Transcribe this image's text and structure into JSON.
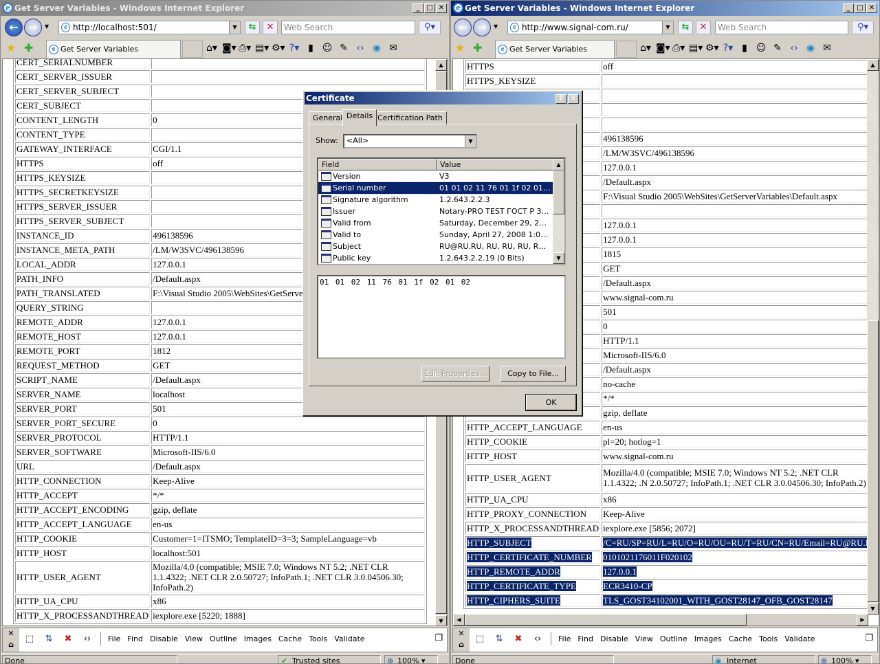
{
  "left_window": {
    "title": "Get Server Variables - Windows Internet Explorer",
    "address": "http://localhost:501/",
    "search_placeholder": "Web Search",
    "tab_label": "Get Server Variables",
    "active": false,
    "rows": [
      [
        "CERT_SERIALNUMBER",
        ""
      ],
      [
        "CERT_SERVER_ISSUER",
        ""
      ],
      [
        "CERT_SERVER_SUBJECT",
        ""
      ],
      [
        "CERT_SUBJECT",
        ""
      ],
      [
        "CONTENT_LENGTH",
        "0"
      ],
      [
        "CONTENT_TYPE",
        ""
      ],
      [
        "GATEWAY_INTERFACE",
        "CGI/1.1"
      ],
      [
        "HTTPS",
        "off"
      ],
      [
        "HTTPS_KEYSIZE",
        ""
      ],
      [
        "HTTPS_SECRETKEYSIZE",
        ""
      ],
      [
        "HTTPS_SERVER_ISSUER",
        ""
      ],
      [
        "HTTPS_SERVER_SUBJECT",
        ""
      ],
      [
        "INSTANCE_ID",
        "496138596"
      ],
      [
        "INSTANCE_META_PATH",
        "/LM/W3SVC/496138596"
      ],
      [
        "LOCAL_ADDR",
        "127.0.0.1"
      ],
      [
        "PATH_INFO",
        "/Default.aspx"
      ],
      [
        "PATH_TRANSLATED",
        "F:\\Visual Studio 2005\\WebSites\\GetServer"
      ],
      [
        "QUERY_STRING",
        ""
      ],
      [
        "REMOTE_ADDR",
        "127.0.0.1"
      ],
      [
        "REMOTE_HOST",
        "127.0.0.1"
      ],
      [
        "REMOTE_PORT",
        "1812"
      ],
      [
        "REQUEST_METHOD",
        "GET"
      ],
      [
        "SCRIPT_NAME",
        "/Default.aspx"
      ],
      [
        "SERVER_NAME",
        "localhost"
      ],
      [
        "SERVER_PORT",
        "501"
      ],
      [
        "SERVER_PORT_SECURE",
        "0"
      ],
      [
        "SERVER_PROTOCOL",
        "HTTP/1.1"
      ],
      [
        "SERVER_SOFTWARE",
        "Microsoft-IIS/6.0"
      ],
      [
        "URL",
        "/Default.aspx"
      ],
      [
        "HTTP_CONNECTION",
        "Keep-Alive"
      ],
      [
        "HTTP_ACCEPT",
        "*/*"
      ],
      [
        "HTTP_ACCEPT_ENCODING",
        "gzip, deflate"
      ],
      [
        "HTTP_ACCEPT_LANGUAGE",
        "en-us"
      ],
      [
        "HTTP_COOKIE",
        "Customer=1=ITSMO; TemplateID=3=3; SampleLanguage=vb"
      ],
      [
        "HTTP_HOST",
        "localhost:501"
      ],
      [
        "HTTP_USER_AGENT",
        "Mozilla/4.0 (compatible; MSIE 7.0; Windows NT 5.2; .NET CLR 1.1.4322; .NET CLR 2.0.50727; InfoPath.1; .NET CLR 3.0.04506.30; InfoPath.2)"
      ],
      [
        "HTTP_UA_CPU",
        "x86"
      ],
      [
        "HTTP_X_PROCESSANDTHREAD",
        "iexplore.exe [5220; 1888]"
      ]
    ],
    "status": "Done",
    "zone": "Trusted sites",
    "zoom": "100%"
  },
  "right_window": {
    "title": "Get Server Variables - Windows Internet Explorer",
    "address": "http://www.signal-com.ru/",
    "search_placeholder": "Web Search",
    "tab_label": "Get Server Variables",
    "active": true,
    "rows": [
      [
        "HTTPS",
        "off"
      ],
      [
        "HTTPS_KEYSIZE",
        ""
      ],
      [
        "",
        ""
      ],
      [
        "",
        ""
      ],
      [
        "",
        ""
      ],
      [
        "",
        "496138596"
      ],
      [
        "",
        "/LM/W3SVC/496138596"
      ],
      [
        "",
        "127.0.0.1"
      ],
      [
        "",
        "/Default.aspx"
      ],
      [
        "",
        "F:\\Visual Studio 2005\\WebSites\\GetServerVariables\\Default.aspx"
      ],
      [
        "",
        ""
      ],
      [
        "",
        "127.0.0.1"
      ],
      [
        "",
        "127.0.0.1"
      ],
      [
        "",
        "1815"
      ],
      [
        "",
        "GET"
      ],
      [
        "",
        "/Default.aspx"
      ],
      [
        "",
        "www.signal-com.ru"
      ],
      [
        "",
        "501"
      ],
      [
        "",
        "0"
      ],
      [
        "",
        "HTTP/1.1"
      ],
      [
        "",
        "Microsoft-IIS/6.0"
      ],
      [
        "",
        "/Default.aspx"
      ],
      [
        "",
        "no-cache"
      ],
      [
        "",
        "*/*"
      ],
      [
        "",
        "gzip, deflate"
      ],
      [
        "HTTP_ACCEPT_LANGUAGE",
        "en-us"
      ],
      [
        "HTTP_COOKIE",
        "pl=20; hotlog=1"
      ],
      [
        "HTTP_HOST",
        "www.signal-com.ru"
      ],
      [
        "HTTP_USER_AGENT",
        "Mozilla/4.0 (compatible; MSIE 7.0; Windows NT 5.2; .NET CLR 1.1.4322; .N 2.0.50727; InfoPath.1; .NET CLR 3.0.04506.30; InfoPath.2)"
      ],
      [
        "HTTP_UA_CPU",
        "x86"
      ],
      [
        "HTTP_PROXY_CONNECTION",
        "Keep-Alive"
      ],
      [
        "HTTP_X_PROCESSANDTHREAD",
        "iexplore.exe [5856; 2072]"
      ],
      [
        "HTTP_SUBJECT",
        "/C=RU/SP=RU/L=RU/O=RU/OU=RU/T=RU/CN=RU/Email=RU@RU.RU",
        true
      ],
      [
        "HTTP_CERTIFICATE_NUMBER",
        "0101021176011F020102",
        true
      ],
      [
        "HTTP_REMOTE_ADDR",
        "127.0.0.1",
        true
      ],
      [
        "HTTP_CERTIFICATE_TYPE",
        "ECR3410-CP",
        true
      ],
      [
        "HTTP_CIPHERS_SUITE",
        "TLS_GOST34102001_WITH_GOST28147_OFB_GOST28147",
        true
      ]
    ],
    "status": "Done",
    "zone": "Internet",
    "zoom": "100%"
  },
  "dev_toolbar": {
    "menu": [
      "File",
      "Find",
      "Disable",
      "View",
      "Outline",
      "Images",
      "Cache",
      "Tools",
      "Validate"
    ]
  },
  "dialog": {
    "title": "Certificate",
    "tabs": [
      "General",
      "Details",
      "Certification Path"
    ],
    "active_tab": "Details",
    "show_label": "Show:",
    "show_value": "<All>",
    "columns": [
      "Field",
      "Value"
    ],
    "fields": [
      {
        "field": "Version",
        "value": "V3"
      },
      {
        "field": "Serial number",
        "value": "01 01 02 11 76 01 1f 02 01 02",
        "selected": true
      },
      {
        "field": "Signature algorithm",
        "value": "1.2.643.2.2.3"
      },
      {
        "field": "Issuer",
        "value": "Notary-PRO TEST ГОСТ Р 34...."
      },
      {
        "field": "Valid from",
        "value": "Saturday, December 29, 2007..."
      },
      {
        "field": "Valid to",
        "value": "Sunday, April 27, 2008 1:08:3..."
      },
      {
        "field": "Subject",
        "value": "RU@RU.RU, RU, RU, RU, RU, ..."
      },
      {
        "field": "Public key",
        "value": "1.2.643.2.2.19 (0 Bits)"
      }
    ],
    "detail_text": "01 01 02 11 76 01 1f 02 01 02",
    "edit_properties": "Edit Properties...",
    "copy_to_file": "Copy to File...",
    "ok": "OK"
  },
  "colors": {
    "selection": "#0a246a",
    "active_title": "#0a246a",
    "dialog_bg": "#d4d0c8"
  }
}
